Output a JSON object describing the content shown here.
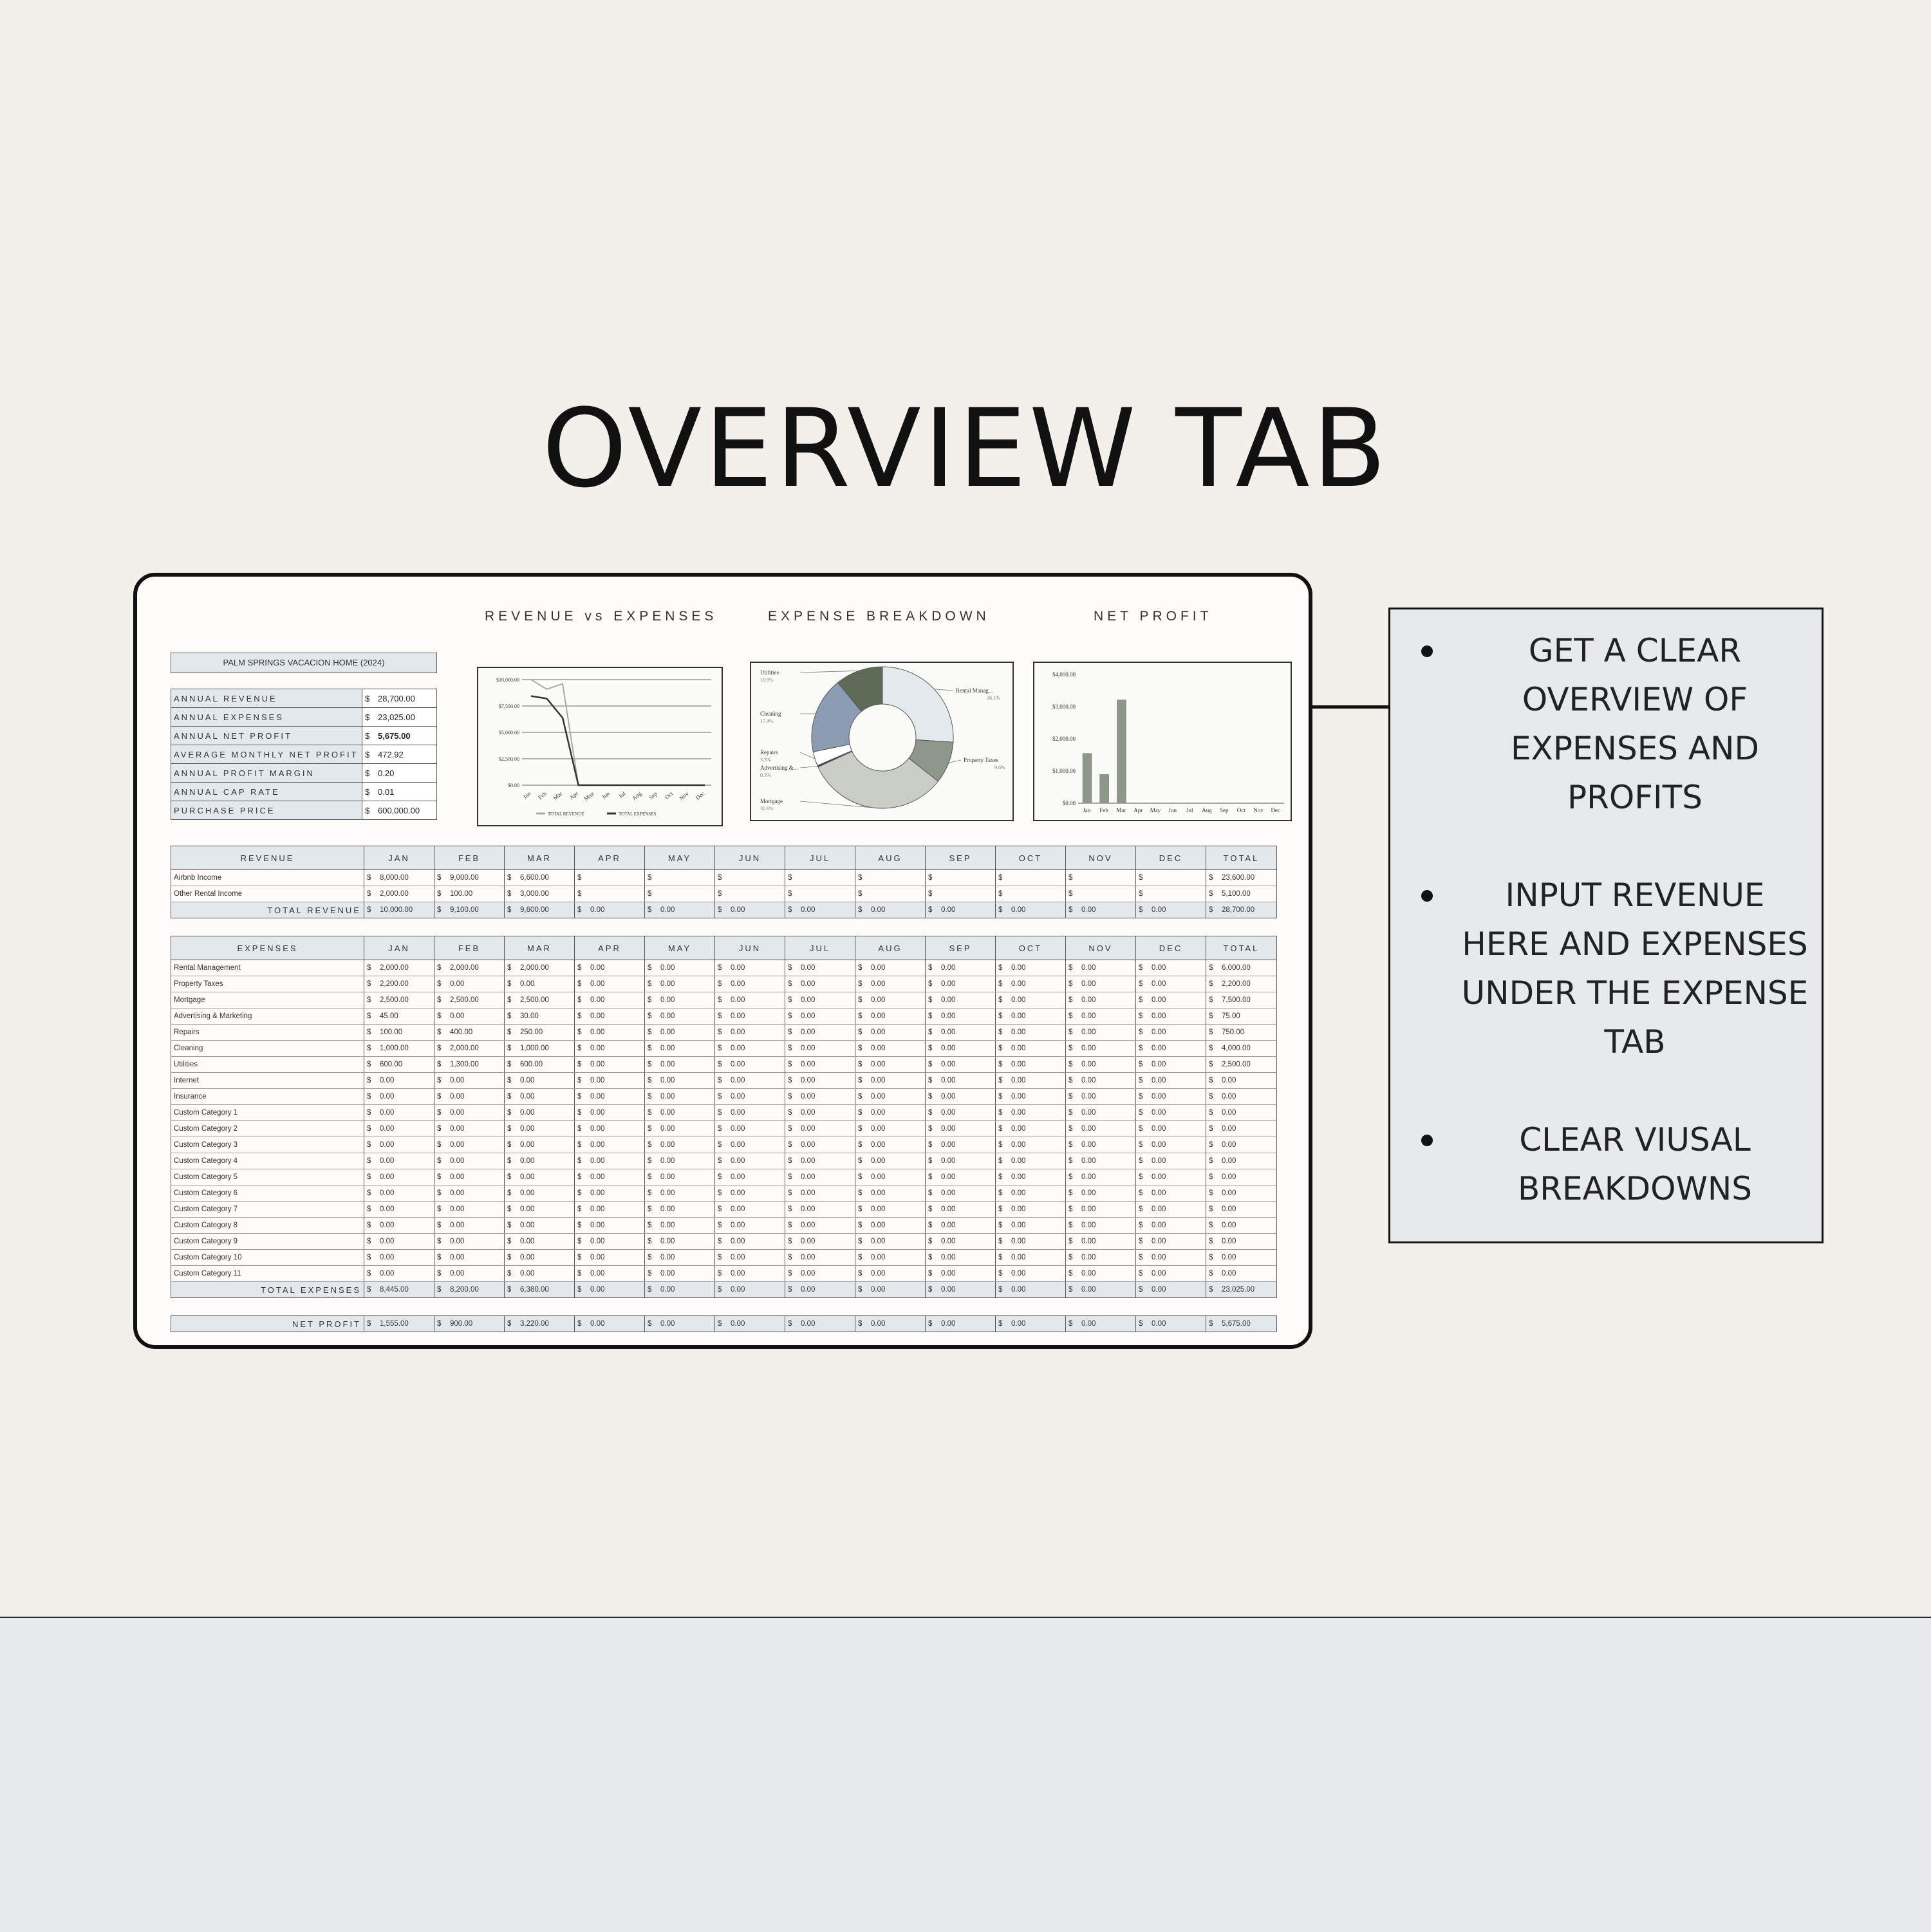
{
  "page_title": "OVERVIEW TAB",
  "callout": {
    "items": [
      "GET A CLEAR OVERVIEW OF EXPENSES AND PROFITS",
      "INPUT REVENUE HERE AND EXPENSES UNDER THE EXPENSE TAB",
      "CLEAR VIUSAL BREAKDOWNS"
    ]
  },
  "sheet": {
    "section_titles": {
      "revenue_vs_expenses": "REVENUE vs EXPENSES",
      "expense_breakdown": "EXPENSE BREAKDOWN",
      "net_profit": "NET PROFIT"
    },
    "property_name": "PALM SPRINGS VACACION HOME (2024)",
    "summary": [
      {
        "label": "ANNUAL REVENUE",
        "cur": "$",
        "value": "28,700.00"
      },
      {
        "label": "ANNUAL EXPENSES",
        "cur": "$",
        "value": "23,025.00"
      },
      {
        "label": "ANNUAL NET PROFIT",
        "cur": "$",
        "value": "5,675.00"
      },
      {
        "label": "AVERAGE MONTHLY NET PROFIT",
        "cur": "$",
        "value": "472.92"
      },
      {
        "label": "ANNUAL PROFIT MARGIN",
        "cur": "$",
        "value": "0.20"
      },
      {
        "label": "ANNUAL CAP RATE",
        "cur": "$",
        "value": "0.01"
      },
      {
        "label": "PURCHASE PRICE",
        "cur": "$",
        "value": "600,000.00"
      }
    ],
    "months": [
      "JAN",
      "FEB",
      "MAR",
      "APR",
      "MAY",
      "JUN",
      "JUL",
      "AUG",
      "SEP",
      "OCT",
      "NOV",
      "DEC"
    ],
    "total_header": "TOTAL",
    "revenue_table": {
      "header": "REVENUE",
      "rows": [
        {
          "label": "Airbnb Income",
          "values": [
            "8,000.00",
            "9,000.00",
            "6,600.00",
            "",
            "",
            "",
            "",
            "",
            "",
            "",
            "",
            ""
          ],
          "total": "23,600.00"
        },
        {
          "label": "Other Rental Income",
          "values": [
            "2,000.00",
            "100.00",
            "3,000.00",
            "",
            "",
            "",
            "",
            "",
            "",
            "",
            "",
            ""
          ],
          "total": "5,100.00"
        }
      ],
      "total_row": {
        "label": "TOTAL REVENUE",
        "values": [
          "10,000.00",
          "9,100.00",
          "9,600.00",
          "0.00",
          "0.00",
          "0.00",
          "0.00",
          "0.00",
          "0.00",
          "0.00",
          "0.00",
          "0.00"
        ],
        "total": "28,700.00"
      }
    },
    "expense_table": {
      "header": "EXPENSES",
      "rows": [
        {
          "label": "Rental Management",
          "values": [
            "2,000.00",
            "2,000.00",
            "2,000.00",
            "0.00",
            "0.00",
            "0.00",
            "0.00",
            "0.00",
            "0.00",
            "0.00",
            "0.00",
            "0.00"
          ],
          "total": "6,000.00"
        },
        {
          "label": "Property Taxes",
          "values": [
            "2,200.00",
            "0.00",
            "0.00",
            "0.00",
            "0.00",
            "0.00",
            "0.00",
            "0.00",
            "0.00",
            "0.00",
            "0.00",
            "0.00"
          ],
          "total": "2,200.00"
        },
        {
          "label": "Mortgage",
          "values": [
            "2,500.00",
            "2,500.00",
            "2,500.00",
            "0.00",
            "0.00",
            "0.00",
            "0.00",
            "0.00",
            "0.00",
            "0.00",
            "0.00",
            "0.00"
          ],
          "total": "7,500.00"
        },
        {
          "label": "Advertising & Marketing",
          "values": [
            "45.00",
            "0.00",
            "30.00",
            "0.00",
            "0.00",
            "0.00",
            "0.00",
            "0.00",
            "0.00",
            "0.00",
            "0.00",
            "0.00"
          ],
          "total": "75.00"
        },
        {
          "label": "Repairs",
          "values": [
            "100.00",
            "400.00",
            "250.00",
            "0.00",
            "0.00",
            "0.00",
            "0.00",
            "0.00",
            "0.00",
            "0.00",
            "0.00",
            "0.00"
          ],
          "total": "750.00"
        },
        {
          "label": "Cleaning",
          "values": [
            "1,000.00",
            "2,000.00",
            "1,000.00",
            "0.00",
            "0.00",
            "0.00",
            "0.00",
            "0.00",
            "0.00",
            "0.00",
            "0.00",
            "0.00"
          ],
          "total": "4,000.00"
        },
        {
          "label": "Utilities",
          "values": [
            "600.00",
            "1,300.00",
            "600.00",
            "0.00",
            "0.00",
            "0.00",
            "0.00",
            "0.00",
            "0.00",
            "0.00",
            "0.00",
            "0.00"
          ],
          "total": "2,500.00"
        },
        {
          "label": "Internet",
          "values": [
            "0.00",
            "0.00",
            "0.00",
            "0.00",
            "0.00",
            "0.00",
            "0.00",
            "0.00",
            "0.00",
            "0.00",
            "0.00",
            "0.00"
          ],
          "total": "0.00"
        },
        {
          "label": "Insurance",
          "values": [
            "0.00",
            "0.00",
            "0.00",
            "0.00",
            "0.00",
            "0.00",
            "0.00",
            "0.00",
            "0.00",
            "0.00",
            "0.00",
            "0.00"
          ],
          "total": "0.00"
        },
        {
          "label": "Custom Category 1",
          "values": [
            "0.00",
            "0.00",
            "0.00",
            "0.00",
            "0.00",
            "0.00",
            "0.00",
            "0.00",
            "0.00",
            "0.00",
            "0.00",
            "0.00"
          ],
          "total": "0.00"
        },
        {
          "label": "Custom Category 2",
          "values": [
            "0.00",
            "0.00",
            "0.00",
            "0.00",
            "0.00",
            "0.00",
            "0.00",
            "0.00",
            "0.00",
            "0.00",
            "0.00",
            "0.00"
          ],
          "total": "0.00"
        },
        {
          "label": "Custom Category 3",
          "values": [
            "0.00",
            "0.00",
            "0.00",
            "0.00",
            "0.00",
            "0.00",
            "0.00",
            "0.00",
            "0.00",
            "0.00",
            "0.00",
            "0.00"
          ],
          "total": "0.00"
        },
        {
          "label": "Custom Category 4",
          "values": [
            "0.00",
            "0.00",
            "0.00",
            "0.00",
            "0.00",
            "0.00",
            "0.00",
            "0.00",
            "0.00",
            "0.00",
            "0.00",
            "0.00"
          ],
          "total": "0.00"
        },
        {
          "label": "Custom Category 5",
          "values": [
            "0.00",
            "0.00",
            "0.00",
            "0.00",
            "0.00",
            "0.00",
            "0.00",
            "0.00",
            "0.00",
            "0.00",
            "0.00",
            "0.00"
          ],
          "total": "0.00"
        },
        {
          "label": "Custom Category 6",
          "values": [
            "0.00",
            "0.00",
            "0.00",
            "0.00",
            "0.00",
            "0.00",
            "0.00",
            "0.00",
            "0.00",
            "0.00",
            "0.00",
            "0.00"
          ],
          "total": "0.00"
        },
        {
          "label": "Custom Category 7",
          "values": [
            "0.00",
            "0.00",
            "0.00",
            "0.00",
            "0.00",
            "0.00",
            "0.00",
            "0.00",
            "0.00",
            "0.00",
            "0.00",
            "0.00"
          ],
          "total": "0.00"
        },
        {
          "label": "Custom Category 8",
          "values": [
            "0.00",
            "0.00",
            "0.00",
            "0.00",
            "0.00",
            "0.00",
            "0.00",
            "0.00",
            "0.00",
            "0.00",
            "0.00",
            "0.00"
          ],
          "total": "0.00"
        },
        {
          "label": "Custom Category 9",
          "values": [
            "0.00",
            "0.00",
            "0.00",
            "0.00",
            "0.00",
            "0.00",
            "0.00",
            "0.00",
            "0.00",
            "0.00",
            "0.00",
            "0.00"
          ],
          "total": "0.00"
        },
        {
          "label": "Custom Category 10",
          "values": [
            "0.00",
            "0.00",
            "0.00",
            "0.00",
            "0.00",
            "0.00",
            "0.00",
            "0.00",
            "0.00",
            "0.00",
            "0.00",
            "0.00"
          ],
          "total": "0.00"
        },
        {
          "label": "Custom Category 11",
          "values": [
            "0.00",
            "0.00",
            "0.00",
            "0.00",
            "0.00",
            "0.00",
            "0.00",
            "0.00",
            "0.00",
            "0.00",
            "0.00",
            "0.00"
          ],
          "total": "0.00"
        }
      ],
      "total_row": {
        "label": "TOTAL EXPENSES",
        "values": [
          "8,445.00",
          "8,200.00",
          "6,380.00",
          "0.00",
          "0.00",
          "0.00",
          "0.00",
          "0.00",
          "0.00",
          "0.00",
          "0.00",
          "0.00"
        ],
        "total": "23,025.00"
      }
    },
    "net_profit_row": {
      "label": "NET PROFIT",
      "values": [
        "1,555.00",
        "900.00",
        "3,220.00",
        "0.00",
        "0.00",
        "0.00",
        "0.00",
        "0.00",
        "0.00",
        "0.00",
        "0.00",
        "0.00"
      ],
      "total": "5,675.00"
    }
  },
  "chart_data": [
    {
      "type": "line",
      "x": [
        "Jan",
        "Feb",
        "Mar",
        "Apr",
        "May",
        "Jun",
        "Jul",
        "Aug",
        "Sep",
        "Oct",
        "Nov",
        "Dec"
      ],
      "series": [
        {
          "name": "TOTAL REVENUE",
          "values": [
            10000,
            9100,
            9600,
            0,
            0,
            0,
            0,
            0,
            0,
            0,
            0,
            0
          ],
          "color": "#a8a8a8"
        },
        {
          "name": "TOTAL EXPENSES",
          "values": [
            8445,
            8200,
            6380,
            0,
            0,
            0,
            0,
            0,
            0,
            0,
            0,
            0
          ],
          "color": "#333333"
        }
      ],
      "yticks": [
        "$0.00",
        "$2,500.00",
        "$5,000.00",
        "$7,500.00",
        "$10,000.00"
      ],
      "ylim": [
        0,
        10000
      ],
      "grid": true,
      "legend": "bottom"
    },
    {
      "type": "pie",
      "donut": true,
      "slices": [
        {
          "label": "Rental Manag...",
          "percent": "26.1%",
          "value": 6000,
          "color": "#e4e9ee"
        },
        {
          "label": "Property Taxes",
          "percent": "9.6%",
          "value": 2200,
          "color": "#8f978b"
        },
        {
          "label": "Mortgage",
          "percent": "32.6%",
          "value": 7500,
          "color": "#c8cdc6"
        },
        {
          "label": "Advertising &...",
          "percent": "0.3%",
          "value": 75,
          "color": "#3a3a3a"
        },
        {
          "label": "Repairs",
          "percent": "3.3%",
          "value": 750,
          "color": "#ffffff"
        },
        {
          "label": "Cleaning",
          "percent": "17.4%",
          "value": 4000,
          "color": "#8a9db3"
        },
        {
          "label": "Utilities",
          "percent": "10.9%",
          "value": 2500,
          "color": "#5e6b56"
        }
      ],
      "legend": "leader-lines"
    },
    {
      "type": "bar",
      "categories": [
        "Jan",
        "Feb",
        "Mar",
        "Apr",
        "May",
        "Jun",
        "Jul",
        "Aug",
        "Sep",
        "Oct",
        "Nov",
        "Dec"
      ],
      "values": [
        1555,
        900,
        3220,
        0,
        0,
        0,
        0,
        0,
        0,
        0,
        0,
        0
      ],
      "yticks": [
        "$0.00",
        "$1,000.00",
        "$2,000.00",
        "$3,000.00",
        "$4,000.00"
      ],
      "ylim": [
        0,
        4000
      ],
      "color": "#8f978b"
    }
  ]
}
